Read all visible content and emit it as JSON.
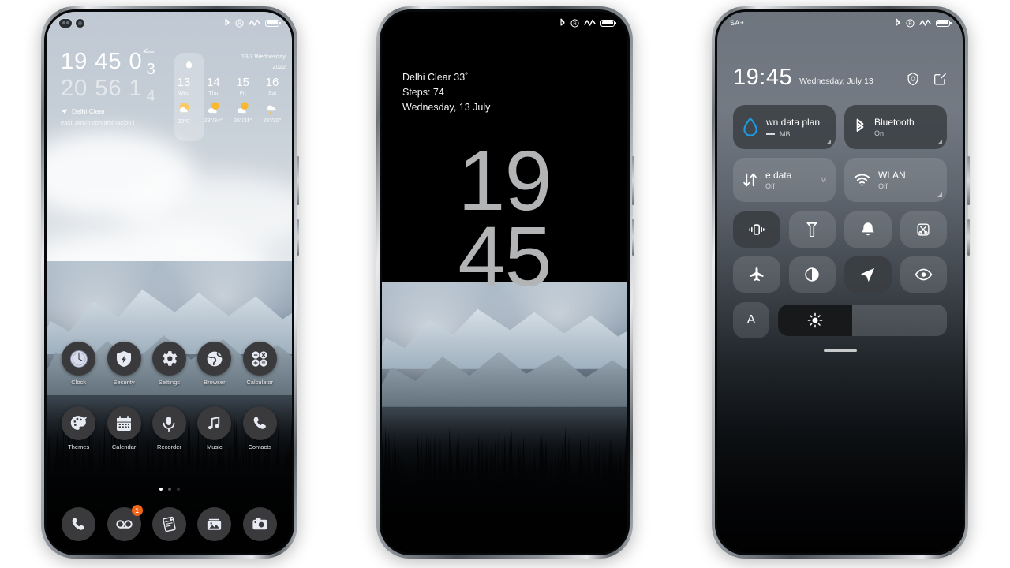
{
  "background_color": "#ffffff",
  "phones": [
    {
      "id": "phone-home-screen",
      "status_bar": {
        "bluetooth": "bluetooth-icon",
        "ringer": "ring-silent-icon",
        "signal": "signal-icon",
        "battery": "battery-icon"
      },
      "clock_widget": {
        "row1": {
          "h": "19",
          "m": "45",
          "big": "0",
          "small": "3"
        },
        "row2": {
          "h": "20",
          "m": "56",
          "big": "1",
          "small": "4"
        },
        "location": "Delhi  Clear",
        "air": "east,1km/h  contaminación l"
      },
      "weather_widget": {
        "date": "13/7 Wednesday",
        "year": "2022",
        "days": [
          {
            "num": "13",
            "day": "Wed",
            "temp": "33℃",
            "icon": "sunny-icon",
            "highlight": true
          },
          {
            "num": "14",
            "day": "Thu",
            "temp": "28°/34°",
            "icon": "partly-cloudy-icon",
            "highlight": false
          },
          {
            "num": "15",
            "day": "Fri",
            "temp": "26°/31°",
            "icon": "partly-cloudy-icon",
            "highlight": false
          },
          {
            "num": "16",
            "day": "Sat",
            "temp": "26°/30°",
            "icon": "rain-icon",
            "highlight": false
          }
        ]
      },
      "apps": [
        [
          {
            "label": "Clock",
            "icon": "clock-icon"
          },
          {
            "label": "Security",
            "icon": "shield-bolt-icon"
          },
          {
            "label": "Settings",
            "icon": "gear-icon"
          },
          {
            "label": "Browser",
            "icon": "globe-icon"
          },
          {
            "label": "Calculator",
            "icon": "calculator-icon"
          }
        ],
        [
          {
            "label": "Themes",
            "icon": "palette-icon"
          },
          {
            "label": "Calendar",
            "icon": "calendar-icon"
          },
          {
            "label": "Recorder",
            "icon": "microphone-icon"
          },
          {
            "label": "Music",
            "icon": "music-note-icon"
          },
          {
            "label": "Contacts",
            "icon": "phone-handset-icon"
          }
        ]
      ],
      "page_dots": {
        "count": 3,
        "active": 0
      },
      "dock": [
        {
          "name": "phone",
          "icon": "phone-handset-icon",
          "badge": null
        },
        {
          "name": "voicemail",
          "icon": "voicemail-icon",
          "badge": "1"
        },
        {
          "name": "notes",
          "icon": "notes-icon",
          "badge": null
        },
        {
          "name": "gallery",
          "icon": "gallery-icon",
          "badge": null
        },
        {
          "name": "camera",
          "icon": "camera-icon",
          "badge": null
        }
      ]
    },
    {
      "id": "phone-lock-screen",
      "status_bar": {
        "bluetooth": "bluetooth-icon",
        "ringer": "ring-silent-icon",
        "signal": "signal-icon",
        "battery": "battery-icon"
      },
      "info_lines": [
        "Delhi Clear 33˚",
        "Steps: 74",
        "Wednesday, 13 July"
      ],
      "clock": {
        "line1": "19",
        "line2": "45"
      }
    },
    {
      "id": "phone-control-center",
      "status_bar": {
        "carrier": "SA+",
        "bluetooth": "bluetooth-icon",
        "ringer": "ring-silent-icon",
        "signal": "signal-icon",
        "battery": "battery-icon"
      },
      "header": {
        "time": "19:45",
        "date": "Wednesday, July 13",
        "actions": [
          {
            "name": "settings-gear",
            "icon": "gear-icon"
          },
          {
            "name": "edit",
            "icon": "edit-pencil-icon"
          }
        ]
      },
      "tiles": [
        {
          "title": "wn data plan",
          "subtitle": "MB",
          "icon": "data-drop-icon",
          "state": "on",
          "accent": "#1b9ae0",
          "has_dash": true
        },
        {
          "title": "Bluetooth",
          "subtitle": "On",
          "icon": "bluetooth-icon",
          "state": "on"
        },
        {
          "title": "e data",
          "subtitle": "Off",
          "icon": "mobile-data-icon",
          "state": "off",
          "trailing": "M"
        },
        {
          "title": "WLAN",
          "subtitle": "Off",
          "icon": "wifi-icon",
          "state": "off"
        }
      ],
      "quick_toggles": [
        {
          "name": "vibrate",
          "icon": "vibrate-icon",
          "state": "on"
        },
        {
          "name": "flashlight",
          "icon": "flashlight-icon",
          "state": "off"
        },
        {
          "name": "do-not-disturb",
          "icon": "bell-icon",
          "state": "off"
        },
        {
          "name": "screenshot",
          "icon": "scissors-crop-icon",
          "state": "off"
        },
        {
          "name": "airplane-mode",
          "icon": "airplane-icon",
          "state": "off"
        },
        {
          "name": "dark-mode",
          "icon": "contrast-circle-icon",
          "state": "off"
        },
        {
          "name": "location",
          "icon": "location-arrow-icon",
          "state": "on"
        },
        {
          "name": "eye-comfort",
          "icon": "eye-icon",
          "state": "off"
        }
      ],
      "brightness": {
        "auto_label": "A",
        "icon": "sun-brightness-icon",
        "level_percent": 44
      }
    }
  ]
}
